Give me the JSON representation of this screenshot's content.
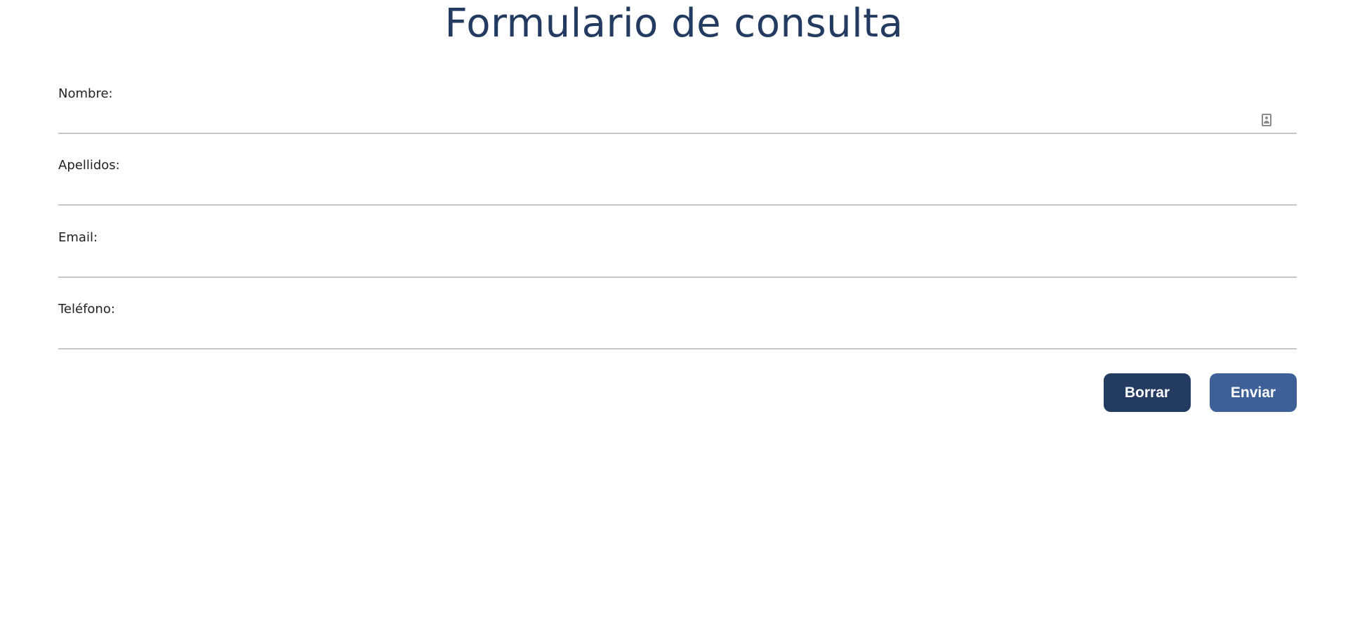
{
  "page": {
    "title": "Formulario de consulta"
  },
  "form": {
    "fields": [
      {
        "label": "Nombre:",
        "value": "",
        "placeholder": ""
      },
      {
        "label": "Apellidos:",
        "value": "",
        "placeholder": ""
      },
      {
        "label": "Email:",
        "value": "",
        "placeholder": ""
      },
      {
        "label": "Teléfono:",
        "value": "",
        "placeholder": ""
      }
    ],
    "autofill_icon": "contact-card-icon",
    "buttons": {
      "reset_label": "Borrar",
      "submit_label": "Enviar"
    }
  },
  "colors": {
    "title": "#243b61",
    "reset_button": "#243b61",
    "submit_button": "#3d6098",
    "field_underline": "#c8c8c8"
  }
}
